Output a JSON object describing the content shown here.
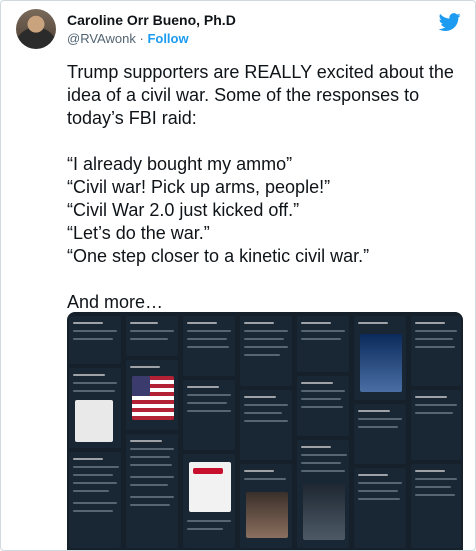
{
  "author": {
    "display_name": "Caroline Orr Bueno, Ph.D",
    "handle": "@RVAwonk",
    "separator": "·",
    "follow_label": "Follow"
  },
  "icons": {
    "brand": "twitter-bird-icon",
    "verified": "none"
  },
  "colors": {
    "accent": "#1d9bf0",
    "text": "#0f1419",
    "muted": "#536471",
    "media_bg": "#15202b"
  },
  "tweet": {
    "lines": [
      "Trump supporters are REALLY excited about the idea of a civil war. Some of the responses to today’s FBI raid:",
      "“I already bought my ammo”",
      "“Civil war! Pick up arms, people!”",
      "“Civil War 2.0 just kicked off.”",
      "“Let’s do the war.”",
      "“One step closer to a kinetic civil war.”",
      "And more…"
    ]
  },
  "media": {
    "description_kind": "collage-of-tweet-screenshots"
  }
}
